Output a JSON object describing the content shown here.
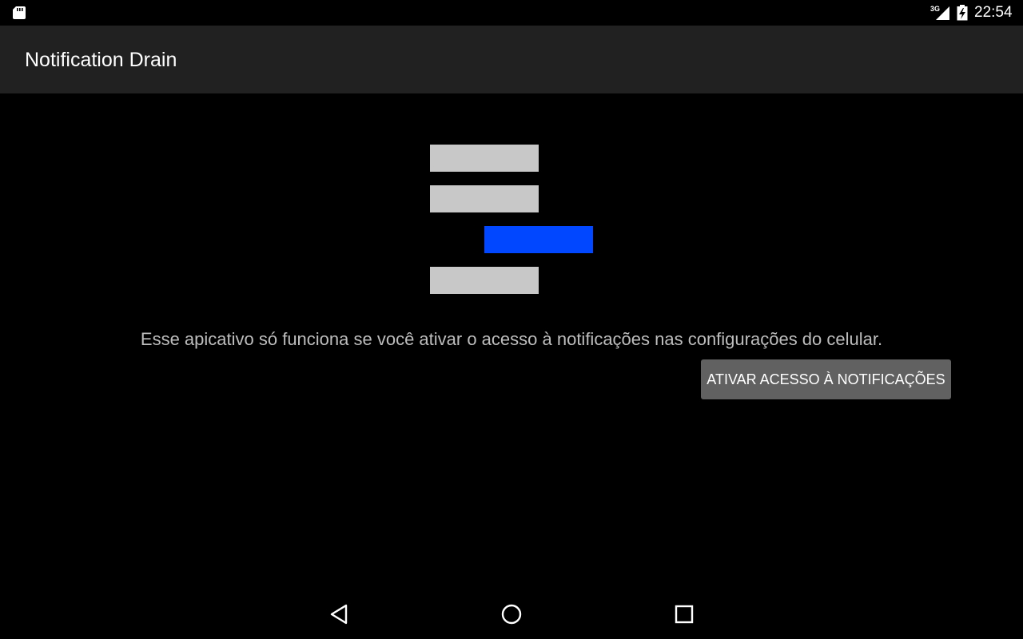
{
  "status_bar": {
    "network_type": "3G",
    "time": "22:54",
    "icons": [
      "sd-card-icon",
      "signal-icon",
      "battery-charging-icon"
    ]
  },
  "app_bar": {
    "title": "Notification Drain"
  },
  "illustration": {
    "bar_color": "#c8c8c8",
    "highlight_color": "#0047ff"
  },
  "main": {
    "message": "Esse apicativo só funciona se você ativar o acesso à notificações nas configurações do celular.",
    "enable_button_label": "ATIVAR ACESSO À NOTIFICAÇÕES"
  },
  "nav_bar": {
    "icons": [
      "back-icon",
      "home-icon",
      "recents-icon"
    ]
  }
}
